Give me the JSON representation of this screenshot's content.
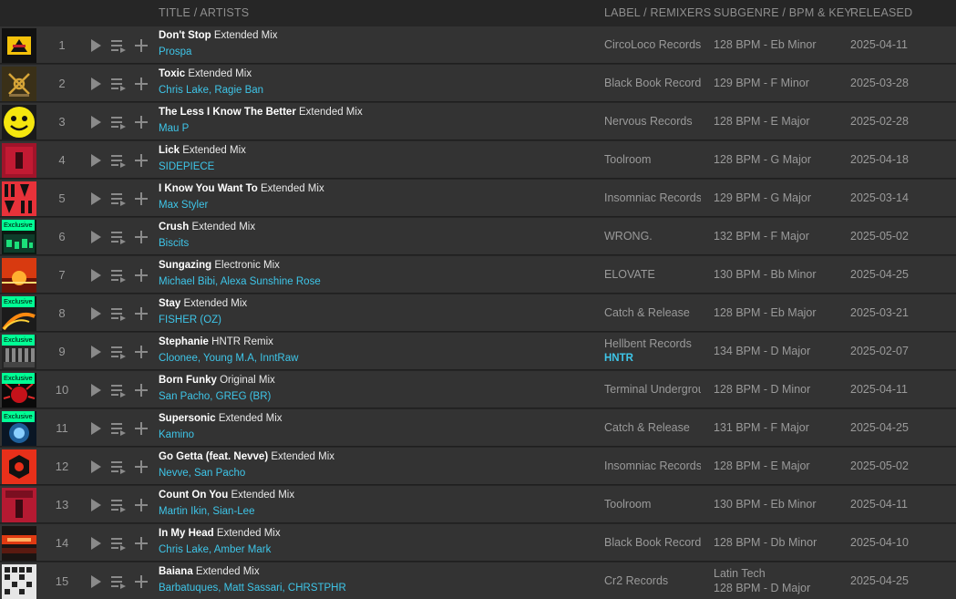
{
  "header": {
    "title": "TITLE / ARTISTS",
    "label": "LABEL / REMIXERS",
    "genre": "SUBGENRE / BPM & KEY",
    "released": "RELEASED"
  },
  "colors": {
    "accent": "#3ec5e8",
    "exclusive": "#01ff95",
    "row_bg": "#333333",
    "page_bg": "#262626"
  },
  "tracks": [
    {
      "num": "1",
      "title": "Don't Stop",
      "mix": "Extended Mix",
      "artists": "Prospa",
      "label": "CircoLoco Records",
      "remixer": "",
      "subgenre": "",
      "bpm_key": "128 BPM - Eb Minor",
      "released": "2025-04-11",
      "exclusive": "",
      "art": "art1"
    },
    {
      "num": "2",
      "title": "Toxic",
      "mix": "Extended Mix",
      "artists": "Chris Lake, Ragie Ban",
      "label": "Black Book Records",
      "remixer": "",
      "subgenre": "",
      "bpm_key": "129 BPM - F Minor",
      "released": "2025-03-28",
      "exclusive": "",
      "art": "art2"
    },
    {
      "num": "3",
      "title": "The Less I Know The Better",
      "mix": "Extended Mix",
      "artists": "Mau P",
      "label": "Nervous Records",
      "remixer": "",
      "subgenre": "",
      "bpm_key": "128 BPM - E Major",
      "released": "2025-02-28",
      "exclusive": "",
      "art": "art3"
    },
    {
      "num": "4",
      "title": "Lick",
      "mix": "Extended Mix",
      "artists": "SIDEPIECE",
      "label": "Toolroom",
      "remixer": "",
      "subgenre": "",
      "bpm_key": "128 BPM - G Major",
      "released": "2025-04-18",
      "exclusive": "",
      "art": "art4"
    },
    {
      "num": "5",
      "title": "I Know You Want To",
      "mix": "Extended Mix",
      "artists": "Max Styler",
      "label": "Insomniac Records",
      "remixer": "",
      "subgenre": "",
      "bpm_key": "129 BPM - G Major",
      "released": "2025-03-14",
      "exclusive": "",
      "art": "art5"
    },
    {
      "num": "6",
      "title": "Crush",
      "mix": "Extended Mix",
      "artists": "Biscits",
      "label": "WRONG.",
      "remixer": "",
      "subgenre": "",
      "bpm_key": "132 BPM - F Major",
      "released": "2025-05-02",
      "exclusive": "Exclusive",
      "art": "art6"
    },
    {
      "num": "7",
      "title": "Sungazing",
      "mix": "Electronic Mix",
      "artists": "Michael Bibi, Alexa Sunshine Rose",
      "label": "ELOVATE",
      "remixer": "",
      "subgenre": "",
      "bpm_key": "130 BPM - Bb Minor",
      "released": "2025-04-25",
      "exclusive": "",
      "art": "art7"
    },
    {
      "num": "8",
      "title": "Stay",
      "mix": "Extended Mix",
      "artists": "FISHER (OZ)",
      "label": "Catch & Release",
      "remixer": "",
      "subgenre": "",
      "bpm_key": "128 BPM - Eb Major",
      "released": "2025-03-21",
      "exclusive": "Exclusive",
      "art": "art8"
    },
    {
      "num": "9",
      "title": "Stephanie",
      "mix": "HNTR Remix",
      "artists": "Cloonee, Young M.A, InntRaw",
      "label": "Hellbent Records",
      "remixer": "HNTR",
      "subgenre": "",
      "bpm_key": "134 BPM - D Major",
      "released": "2025-02-07",
      "exclusive": "Exclusive",
      "art": "art9"
    },
    {
      "num": "10",
      "title": "Born Funky",
      "mix": "Original Mix",
      "artists": "San Pacho, GREG (BR)",
      "label": "Terminal Underground",
      "remixer": "",
      "subgenre": "",
      "bpm_key": "128 BPM - D Minor",
      "released": "2025-04-11",
      "exclusive": "Exclusive",
      "art": "art10"
    },
    {
      "num": "11",
      "title": "Supersonic",
      "mix": "Extended Mix",
      "artists": "Kamino",
      "label": "Catch & Release",
      "remixer": "",
      "subgenre": "",
      "bpm_key": "131 BPM - F Major",
      "released": "2025-04-25",
      "exclusive": "Exclusive",
      "art": "art11"
    },
    {
      "num": "12",
      "title": "Go Getta (feat. Nevve)",
      "mix": "Extended Mix",
      "artists": "Nevve, San Pacho",
      "label": "Insomniac Records",
      "remixer": "",
      "subgenre": "",
      "bpm_key": "128 BPM - E Major",
      "released": "2025-05-02",
      "exclusive": "",
      "art": "art12"
    },
    {
      "num": "13",
      "title": "Count On You",
      "mix": "Extended Mix",
      "artists": "Martin Ikin, Sian-Lee",
      "label": "Toolroom",
      "remixer": "",
      "subgenre": "",
      "bpm_key": "130 BPM - Eb Minor",
      "released": "2025-04-11",
      "exclusive": "",
      "art": "art13"
    },
    {
      "num": "14",
      "title": "In My Head",
      "mix": "Extended Mix",
      "artists": "Chris Lake, Amber Mark",
      "label": "Black Book Records",
      "remixer": "",
      "subgenre": "",
      "bpm_key": "128 BPM - Db Minor",
      "released": "2025-04-10",
      "exclusive": "",
      "art": "art14"
    },
    {
      "num": "15",
      "title": "Baiana",
      "mix": "Extended Mix",
      "artists": "Barbatuques, Matt Sassari, CHRSTPHR",
      "label": "Cr2 Records",
      "remixer": "",
      "subgenre": "Latin Tech",
      "bpm_key": "128 BPM - D Major",
      "released": "2025-04-25",
      "exclusive": "",
      "art": "art15"
    }
  ]
}
